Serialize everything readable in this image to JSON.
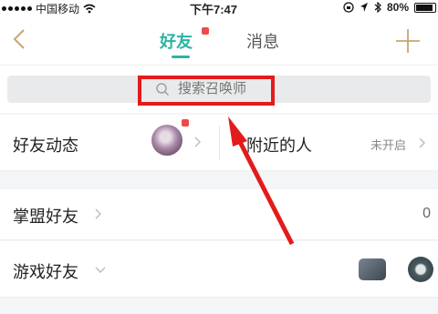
{
  "status_bar": {
    "carrier": "中国移动",
    "time": "下午7:47",
    "battery": "80%"
  },
  "header": {
    "tabs": [
      {
        "label": "好友",
        "active": true,
        "has_badge": true
      },
      {
        "label": "消息",
        "active": false
      }
    ],
    "accent_color": "#2bb3a3",
    "badge_color": "#ef4a4a"
  },
  "search": {
    "placeholder": "搜索召唤师"
  },
  "sections": {
    "friend_activity": {
      "label": "好友动态"
    },
    "nearby": {
      "label": "附近的人",
      "status": "未开启"
    },
    "league_friends": {
      "label": "掌盟好友",
      "count": "0"
    },
    "game_friends": {
      "label": "游戏好友"
    }
  },
  "annotation": {
    "color": "#e31b1b"
  }
}
